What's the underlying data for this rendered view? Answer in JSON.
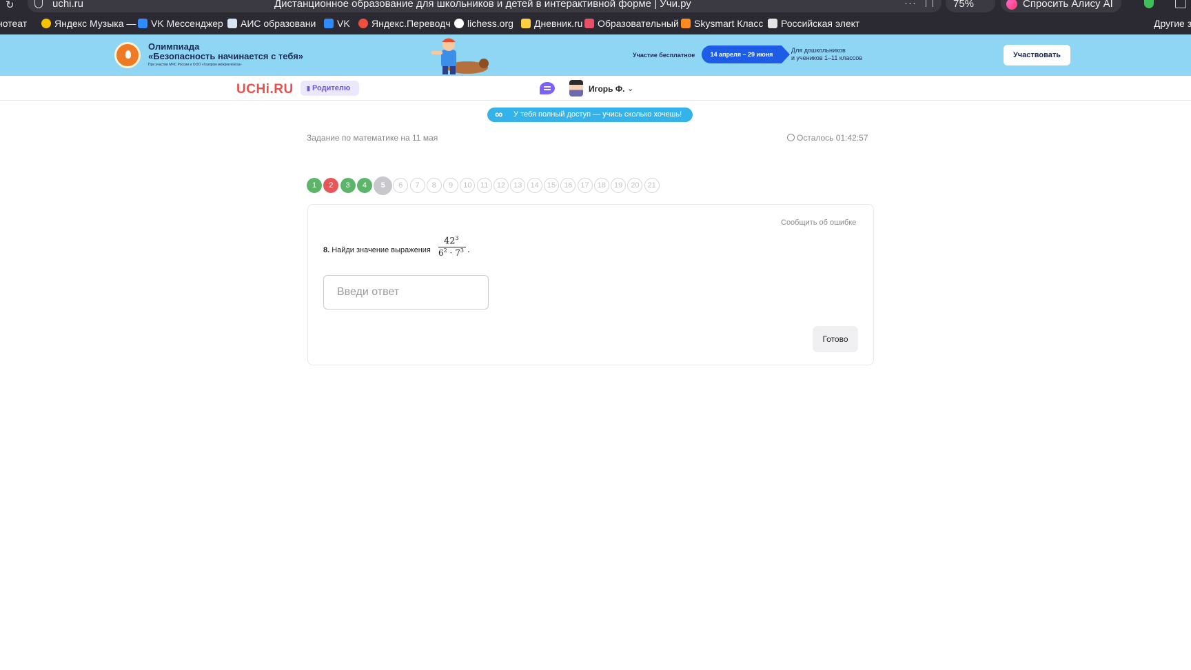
{
  "browser": {
    "url": "uchi.ru",
    "page_title": "Дистанционное образование для школьников и детей в интерактивной форме | Учи.ру",
    "zoom": "75%",
    "alice_label": "Спросить Алису AI"
  },
  "bookmarks": {
    "items": [
      "нотеат",
      "Яндекс Музыка —",
      "VK Мессенджер",
      "АИС образовани",
      "VK",
      "Яндекс.Переводч",
      "lichess.org",
      "Дневник.ru",
      "Образовательный",
      "Skysmart Класс",
      "Российская элект"
    ],
    "other": "Другие з"
  },
  "banner": {
    "title_line1": "Олимпиада",
    "title_line2": "«Безопасность начинается с тебя»",
    "small_print": "При участии МЧС России и ООО «Газпром межрегионгаз»",
    "free": "Участие бесплатное",
    "dates": "14 апреля – 29 июня",
    "audience_line1": "Для дошкольников",
    "audience_line2": "и учеников 1–11 классов",
    "button": "Участвовать"
  },
  "header": {
    "logo": "UCHi.RU",
    "parent_label": "Родителю",
    "user_name": "Игорь Ф."
  },
  "access_banner": "У тебя полный доступ — учись сколько хочешь!",
  "task": {
    "title": "Задание по математике на 11 мая",
    "timer": "Осталось 01:42:57",
    "steps": [
      {
        "n": "1",
        "status": "ok"
      },
      {
        "n": "2",
        "status": "bad"
      },
      {
        "n": "3",
        "status": "ok"
      },
      {
        "n": "4",
        "status": "ok"
      },
      {
        "n": "5",
        "status": "current"
      },
      {
        "n": "6",
        "status": "todo"
      },
      {
        "n": "7",
        "status": "todo"
      },
      {
        "n": "8",
        "status": "todo"
      },
      {
        "n": "9",
        "status": "todo"
      },
      {
        "n": "10",
        "status": "todo"
      },
      {
        "n": "11",
        "status": "todo"
      },
      {
        "n": "12",
        "status": "todo"
      },
      {
        "n": "13",
        "status": "todo"
      },
      {
        "n": "14",
        "status": "todo"
      },
      {
        "n": "15",
        "status": "todo"
      },
      {
        "n": "16",
        "status": "todo"
      },
      {
        "n": "17",
        "status": "todo"
      },
      {
        "n": "18",
        "status": "todo"
      },
      {
        "n": "19",
        "status": "todo"
      },
      {
        "n": "20",
        "status": "todo"
      },
      {
        "n": "21",
        "status": "todo"
      }
    ],
    "report": "Сообщить об ошибке",
    "question_number": "8.",
    "question_text": "Найди значение выражения",
    "fraction": {
      "num_base": "42",
      "num_exp": "3",
      "den_base1": "6",
      "den_exp1": "2",
      "den_op": " · ",
      "den_base2": "7",
      "den_exp2": "3",
      "tail": "."
    },
    "answer_placeholder": "Введи ответ",
    "answer_value": "",
    "submit": "Готово"
  },
  "colors": {
    "step_ok": "#5cb569",
    "step_bad": "#e5585a",
    "step_current": "#c8c8cc",
    "banner_bg": "#8fd6f5",
    "access_bg": "#34b3ea",
    "logo": "#e8504b"
  }
}
